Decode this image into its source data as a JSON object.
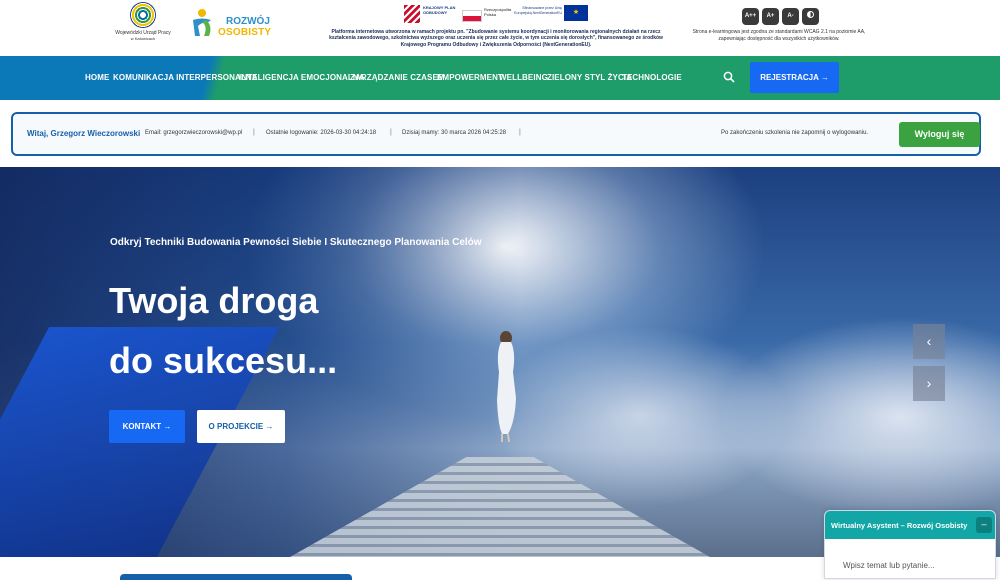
{
  "header": {
    "logo1": {
      "title": "Wojewódzki Urząd Pracy",
      "subtitle": "w Katowicach"
    },
    "logo2": {
      "line1": "ROZWÓJ",
      "line2": "OSOBISTY"
    },
    "eu": {
      "kpo": "KRAJOWY PLAN ODBUDOWY",
      "pl": "Rzeczpospolita Polska",
      "eu_text": "Sfinansowane przez Unię Europejską NextGenerationEU"
    },
    "project_text": "Platforma internetowa utworzona w ramach projektu pn. \"Zbudowanie systemu koordynacji i monitorowania regionalnych działań na rzecz kształcenia zawodowego, szkolnictwa wyższego oraz uczenia się przez całe życie, w tym uczenia się dorosłych\", finansowanego ze środków Krajowego Programu Odbudowy i Zwiększenia Odporności (NextGenerationEU).",
    "a11y": {
      "a_plus_plus": "A++",
      "a_plus": "A+",
      "a_minus": "A-"
    },
    "wcag_text": "Strona e-learningowa jest zgodna ze standardami WCAG 2.1 na poziomie AA, zapewniając dostępność dla wszystkich użytkowników."
  },
  "nav": {
    "items": [
      "HOME",
      "KOMUNIKACJA INTERPERSONALNA",
      "INTELIGENCJA EMOCJONALNA",
      "ZARZĄDZANIE CZASEM",
      "EMPOWERMENT",
      "WELLBEING",
      "ZIELONY STYL ŻYCIA",
      "TECHNOLOGIE"
    ],
    "register": "REJESTRACJA →"
  },
  "userbar": {
    "greeting": "Witaj, Grzegorz Wieczorowski",
    "email": "Email: grzegorzwieczorowski@wp.pl",
    "last_login": "Ostatnie logowanie: 2026-03-30 04:24:18",
    "today": "Dzisiaj mamy: 30 marca 2026 04:25:28",
    "note": "Po zakończeniu szkolenia nie zapomnij o wylogowaniu.",
    "logout": "Wyloguj się"
  },
  "hero": {
    "subtitle": "Odkryj Techniki Budowania Pewności Siebie I Skutecznego Planowania Celów",
    "title_line1": "Twoja droga",
    "title_line2": "do sukcesu...",
    "btn_contact": "KONTAKT →",
    "btn_project": "O PROJEKCIE →",
    "prev": "‹",
    "next": "›"
  },
  "chat": {
    "title": "Wirtualny Asystent – Rozwój Osobisty",
    "minimize": "–",
    "placeholder": "Wpisz temat lub pytanie..."
  },
  "colors": {
    "primary": "#1769f3",
    "nav_green": "#1e9c6a",
    "nav_blue": "#0b79b8",
    "logout_green": "#3aa23f",
    "chat_teal": "#12a6a6"
  }
}
